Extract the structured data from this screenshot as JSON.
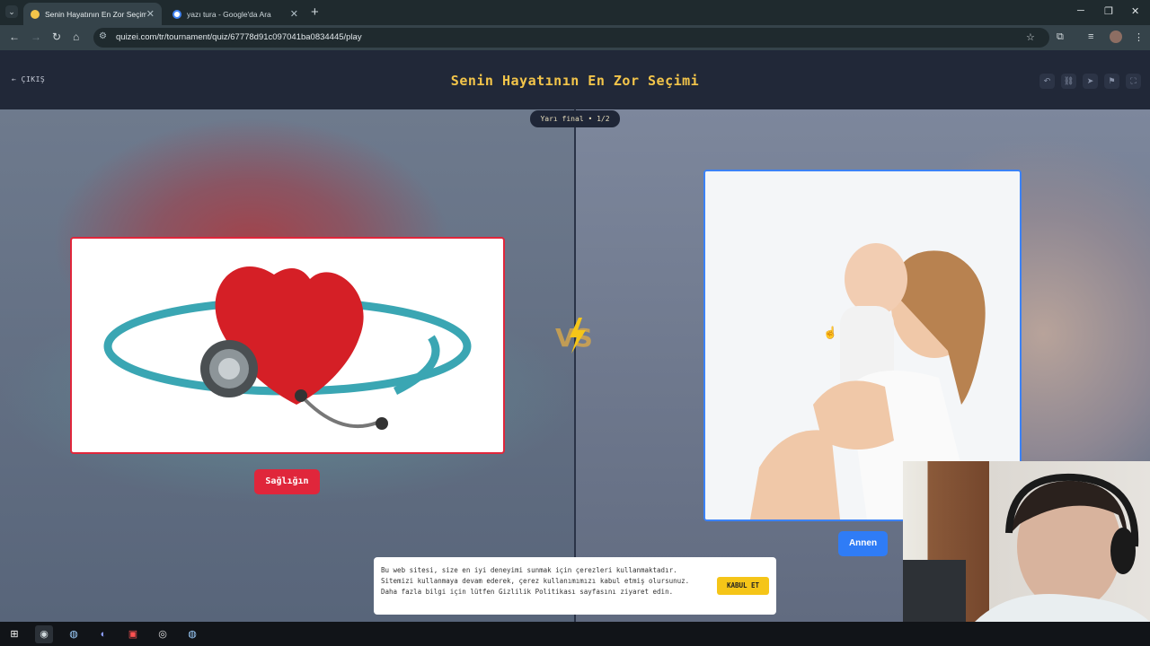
{
  "browser": {
    "tabs": [
      {
        "title": "Senin Hayatının En Zor Seçimi - ..."
      },
      {
        "title": "yazı tura - Google'da Ara"
      }
    ],
    "url": "quizei.com/tr/tournament/quiz/67778d91c097041ba0834445/play"
  },
  "header": {
    "exit_label": "ÇIKIŞ",
    "title": "Senin Hayatının En Zor Seçimi",
    "icons": [
      "undo-icon",
      "link-icon",
      "send-icon",
      "flag-icon",
      "fullscreen-icon"
    ]
  },
  "round": {
    "badge": "Yarı final • 1/2"
  },
  "left_choice": {
    "label": "Sağlığın",
    "accent": "#e0263b"
  },
  "right_choice": {
    "label": "Annen",
    "accent": "#2f7cf6"
  },
  "cookie": {
    "text": "Bu web sitesi, size en iyi deneyimi sunmak için çerezleri kullanmaktadır. Sitemizi kullanmaya devam ederek, çerez kullanımımızı kabul etmiş olursunuz. Daha fazla bilgi için lütfen Gizlilik Politikası sayfasını ziyaret edin.",
    "button": "KABUL ET"
  },
  "taskbar": {
    "apps": [
      "windows-start-icon",
      "chrome-icon",
      "steam-icon",
      "discord-icon",
      "app-icon",
      "obs-icon",
      "steam-icon"
    ]
  }
}
